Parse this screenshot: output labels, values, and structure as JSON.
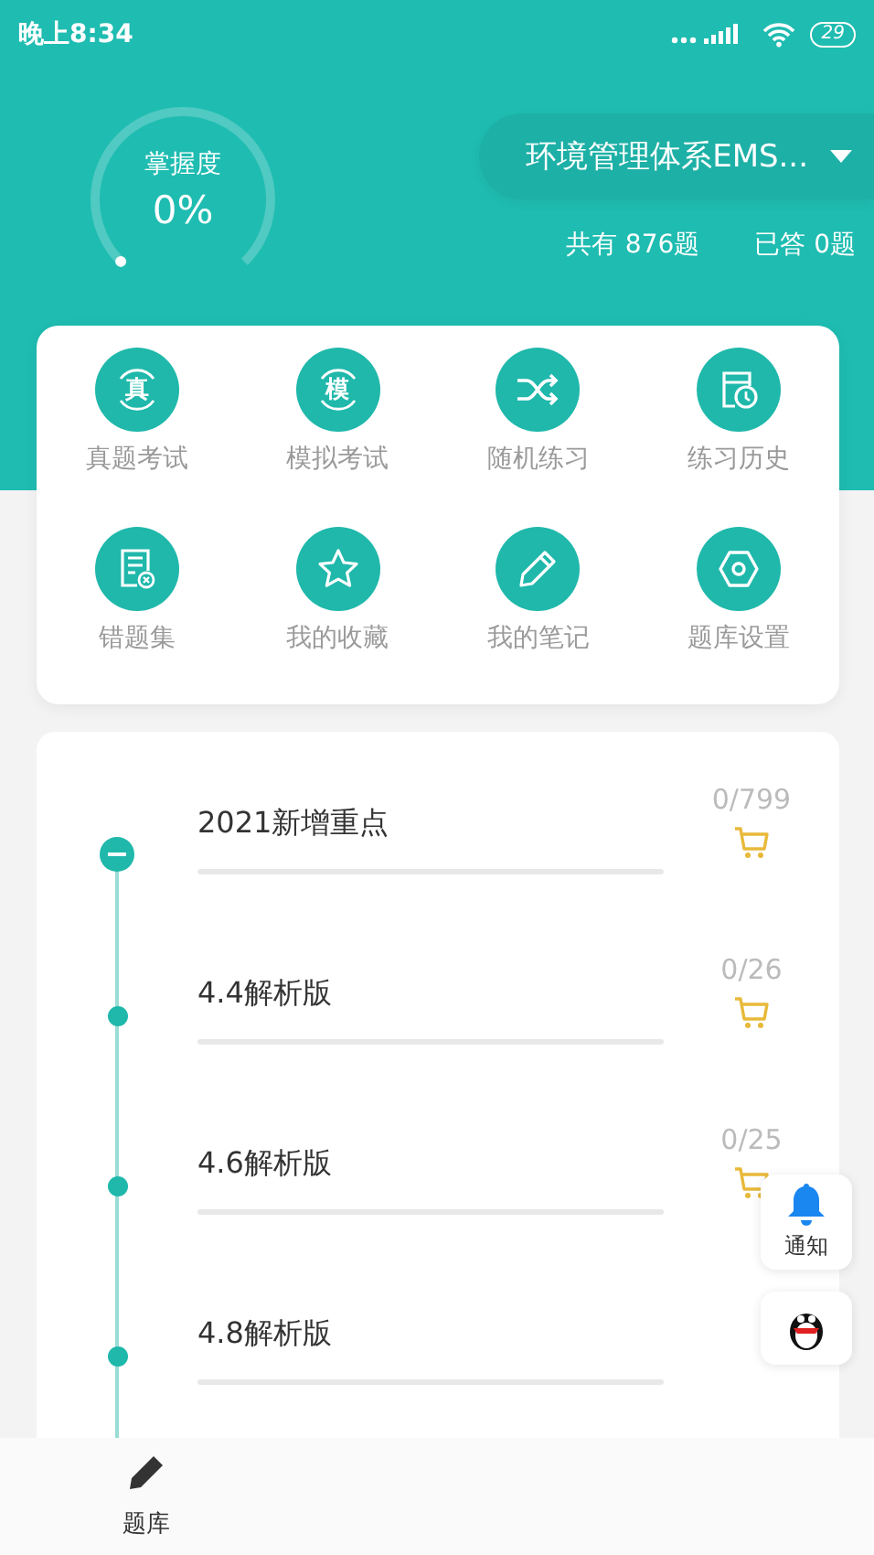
{
  "status_bar": {
    "time": "晚上8:34",
    "battery": "29"
  },
  "mastery": {
    "label": "掌握度",
    "value": "0%"
  },
  "subject": {
    "title": "环境管理体系EMS..."
  },
  "stats": [
    {
      "text": "共有 876题"
    },
    {
      "text": "已答 0题"
    }
  ],
  "grid": [
    {
      "kind": "glyph",
      "glyph": "真",
      "label": "真题考试"
    },
    {
      "kind": "glyph",
      "glyph": "模",
      "label": "模拟考试"
    },
    {
      "kind": "shuffle",
      "label": "随机练习"
    },
    {
      "kind": "history",
      "label": "练习历史"
    },
    {
      "kind": "wrong",
      "label": "错题集"
    },
    {
      "kind": "star",
      "label": "我的收藏"
    },
    {
      "kind": "pencil",
      "label": "我的笔记"
    },
    {
      "kind": "settings",
      "label": "题库设置"
    }
  ],
  "chapters": [
    {
      "title": "2021新增重点",
      "count": "0/799",
      "level": 0,
      "expanded": true
    },
    {
      "title": "4.4解析版",
      "count": "0/26",
      "level": 0,
      "expanded": false
    },
    {
      "title": "4.6解析版",
      "count": "0/25",
      "level": 0,
      "expanded": false
    },
    {
      "title": "4.8解析版",
      "level": 0,
      "expanded": false
    }
  ],
  "float_buttons": [
    {
      "kind": "bell",
      "label": "通知"
    },
    {
      "kind": "penguin"
    }
  ],
  "bottom_nav": [
    {
      "label": "题库"
    }
  ]
}
